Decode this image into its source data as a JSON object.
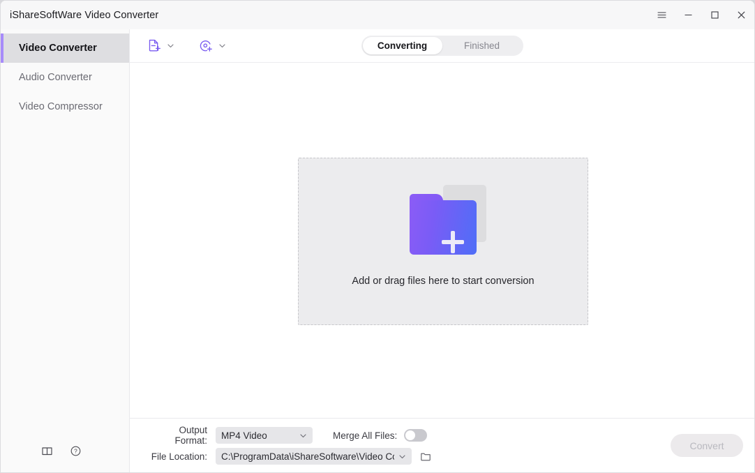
{
  "window": {
    "title": "iShareSoftWare Video Converter",
    "controls": [
      {
        "name": "menu-button",
        "icon": "hamburger-icon"
      },
      {
        "name": "minimize-button",
        "icon": "minimize-icon"
      },
      {
        "name": "maximize-button",
        "icon": "maximize-icon"
      },
      {
        "name": "close-button",
        "icon": "close-icon"
      }
    ]
  },
  "sidebar": {
    "items": [
      {
        "label": "Video Converter",
        "active": true
      },
      {
        "label": "Audio Converter",
        "active": false
      },
      {
        "label": "Video Compressor",
        "active": false
      }
    ],
    "bottom_icons": [
      {
        "name": "guide-book-icon"
      },
      {
        "name": "help-circle-icon"
      }
    ],
    "accent_color": "#a78bfa"
  },
  "toolbar": {
    "add_file": {
      "icon": "add-file-icon",
      "dropdown": "chevron-down-icon"
    },
    "add_disc": {
      "icon": "add-disc-icon",
      "dropdown": "chevron-down-icon"
    },
    "tabs": [
      {
        "label": "Converting",
        "active": true
      },
      {
        "label": "Finished",
        "active": false
      }
    ],
    "icon_color": "#7a5cf0"
  },
  "dropzone": {
    "text": "Add or drag files here to start conversion",
    "folder_gradient_from": "#8b5cf6",
    "folder_gradient_to": "#4f6ef7",
    "plus_icon": "plus-icon"
  },
  "bottom": {
    "output_format_label": "Output Format:",
    "output_format_value": "MP4 Video",
    "merge_label": "Merge All Files:",
    "merge_enabled": false,
    "file_location_label": "File Location:",
    "file_location_value": "C:\\ProgramData\\iShareSoftware\\Video Conve",
    "browse_icon": "folder-icon",
    "convert_label": "Convert",
    "convert_enabled": false
  }
}
